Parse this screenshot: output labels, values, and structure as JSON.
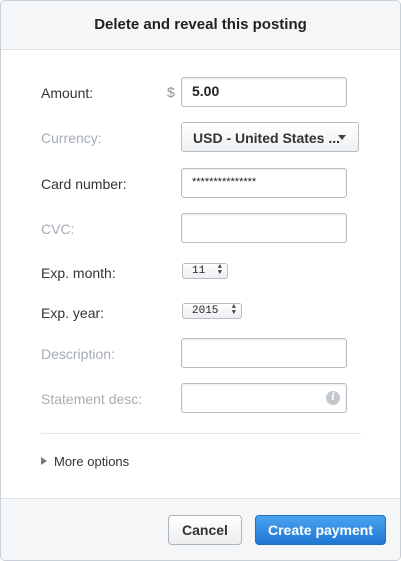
{
  "dialog": {
    "title": "Delete and reveal this posting"
  },
  "form": {
    "amount": {
      "label": "Amount:",
      "currency_sign": "$",
      "value": "5.00"
    },
    "currency": {
      "label": "Currency:",
      "selected": "USD - United States ..."
    },
    "card_number": {
      "label": "Card number:",
      "value": "***************"
    },
    "cvc": {
      "label": "CVC:",
      "value": ""
    },
    "exp_month": {
      "label": "Exp. month:",
      "selected": "11"
    },
    "exp_year": {
      "label": "Exp. year:",
      "selected": "2015"
    },
    "description": {
      "label": "Description:",
      "value": ""
    },
    "statement_desc": {
      "label": "Statement desc:",
      "value": "",
      "info_icon": "info-icon"
    }
  },
  "more_options": {
    "label": "More options"
  },
  "footer": {
    "cancel_label": "Cancel",
    "create_label": "Create payment"
  },
  "colors": {
    "primary": "#2077d4",
    "muted_label": "#a6adb5"
  }
}
